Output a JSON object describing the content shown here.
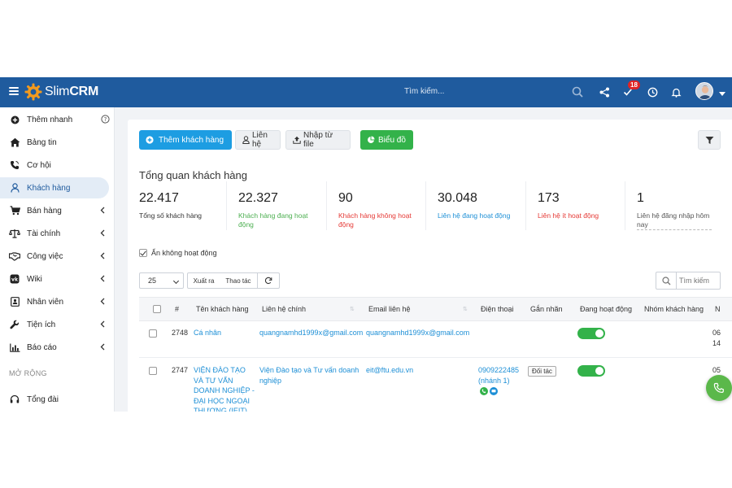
{
  "header": {
    "logo_slim": "Slim",
    "logo_crm": "CRM",
    "search_placeholder": "Tìm kiếm...",
    "notification_count": "18"
  },
  "sidebar": {
    "items": [
      {
        "label": "Thêm nhanh",
        "icon": "plus-circle-icon"
      },
      {
        "label": "Bảng tin",
        "icon": "home-icon"
      },
      {
        "label": "Cơ hội",
        "icon": "phone-icon"
      },
      {
        "label": "Khách hàng",
        "icon": "user-icon"
      },
      {
        "label": "Bán hàng",
        "icon": "cart-icon"
      },
      {
        "label": "Tài chính",
        "icon": "scale-icon"
      },
      {
        "label": "Công việc",
        "icon": "handshake-icon"
      },
      {
        "label": "Wiki",
        "icon": "vk-icon"
      },
      {
        "label": "Nhân viên",
        "icon": "id-card-icon"
      },
      {
        "label": "Tiện ích",
        "icon": "wrench-icon"
      },
      {
        "label": "Báo cáo",
        "icon": "bar-chart-icon"
      },
      {
        "label": "Tổng đài",
        "icon": "headset-icon"
      }
    ],
    "section_label": "MỞ RỘNG"
  },
  "toolbar": {
    "add_customer": "Thêm khách hàng",
    "contacts": "Liên hệ",
    "import_file": "Nhập từ file",
    "chart": "Biểu đồ"
  },
  "overview": {
    "title": "Tổng quan khách hàng",
    "stats": [
      {
        "value": "22.417",
        "label": "Tổng số khách hàng",
        "color": "#333333"
      },
      {
        "value": "22.327",
        "label": "Khách hàng đang hoạt động",
        "color": "#4caf50"
      },
      {
        "value": "90",
        "label": "Khách hàng không hoạt động",
        "color": "#e53935"
      },
      {
        "value": "30.048",
        "label": "Liên hệ đang hoạt động",
        "color": "#1d8fd6"
      },
      {
        "value": "173",
        "label": "Liên hệ ít hoạt động",
        "color": "#e53935"
      },
      {
        "value": "1",
        "label": "Liên hệ đăng nhập hôm nay",
        "color": "#555555"
      }
    ]
  },
  "filters": {
    "hide_inactive": "Ẩn không hoạt động",
    "page_size": "25",
    "export": "Xuất ra",
    "actions": "Thao tác",
    "search_placeholder": "Tìm kiếm"
  },
  "table": {
    "columns": [
      "#",
      "Tên khách hàng",
      "Liên hệ chính",
      "Email liên hệ",
      "Điện thoại",
      "Gắn nhãn",
      "Đang hoạt động",
      "Nhóm khách hàng",
      "N"
    ],
    "rows": [
      {
        "id": "2748",
        "name": "Cá nhân",
        "contact": "quangnamhd1999x@gmail.com",
        "email": "quangnamhd1999x@gmail.com",
        "phone": "",
        "tag": "",
        "active": true,
        "group": "",
        "date": "06\n14"
      },
      {
        "id": "2747",
        "name": "VIỆN ĐÀO TẠO VÀ TƯ VẤN DOANH NGHIỆP - ĐẠI HỌC NGOẠI THƯƠNG (IEIT)",
        "contact": "Viện Đào tạo và Tư vấn doanh nghiệp",
        "email": "eit@ftu.edu.vn",
        "phone": "0909222485 (nhánh 1)",
        "tag": "Đối tác",
        "active": true,
        "group": "",
        "date": "05"
      }
    ]
  },
  "colors": {
    "header_bg": "#1f5b9e",
    "primary": "#1d9de2",
    "success": "#33b24a"
  }
}
